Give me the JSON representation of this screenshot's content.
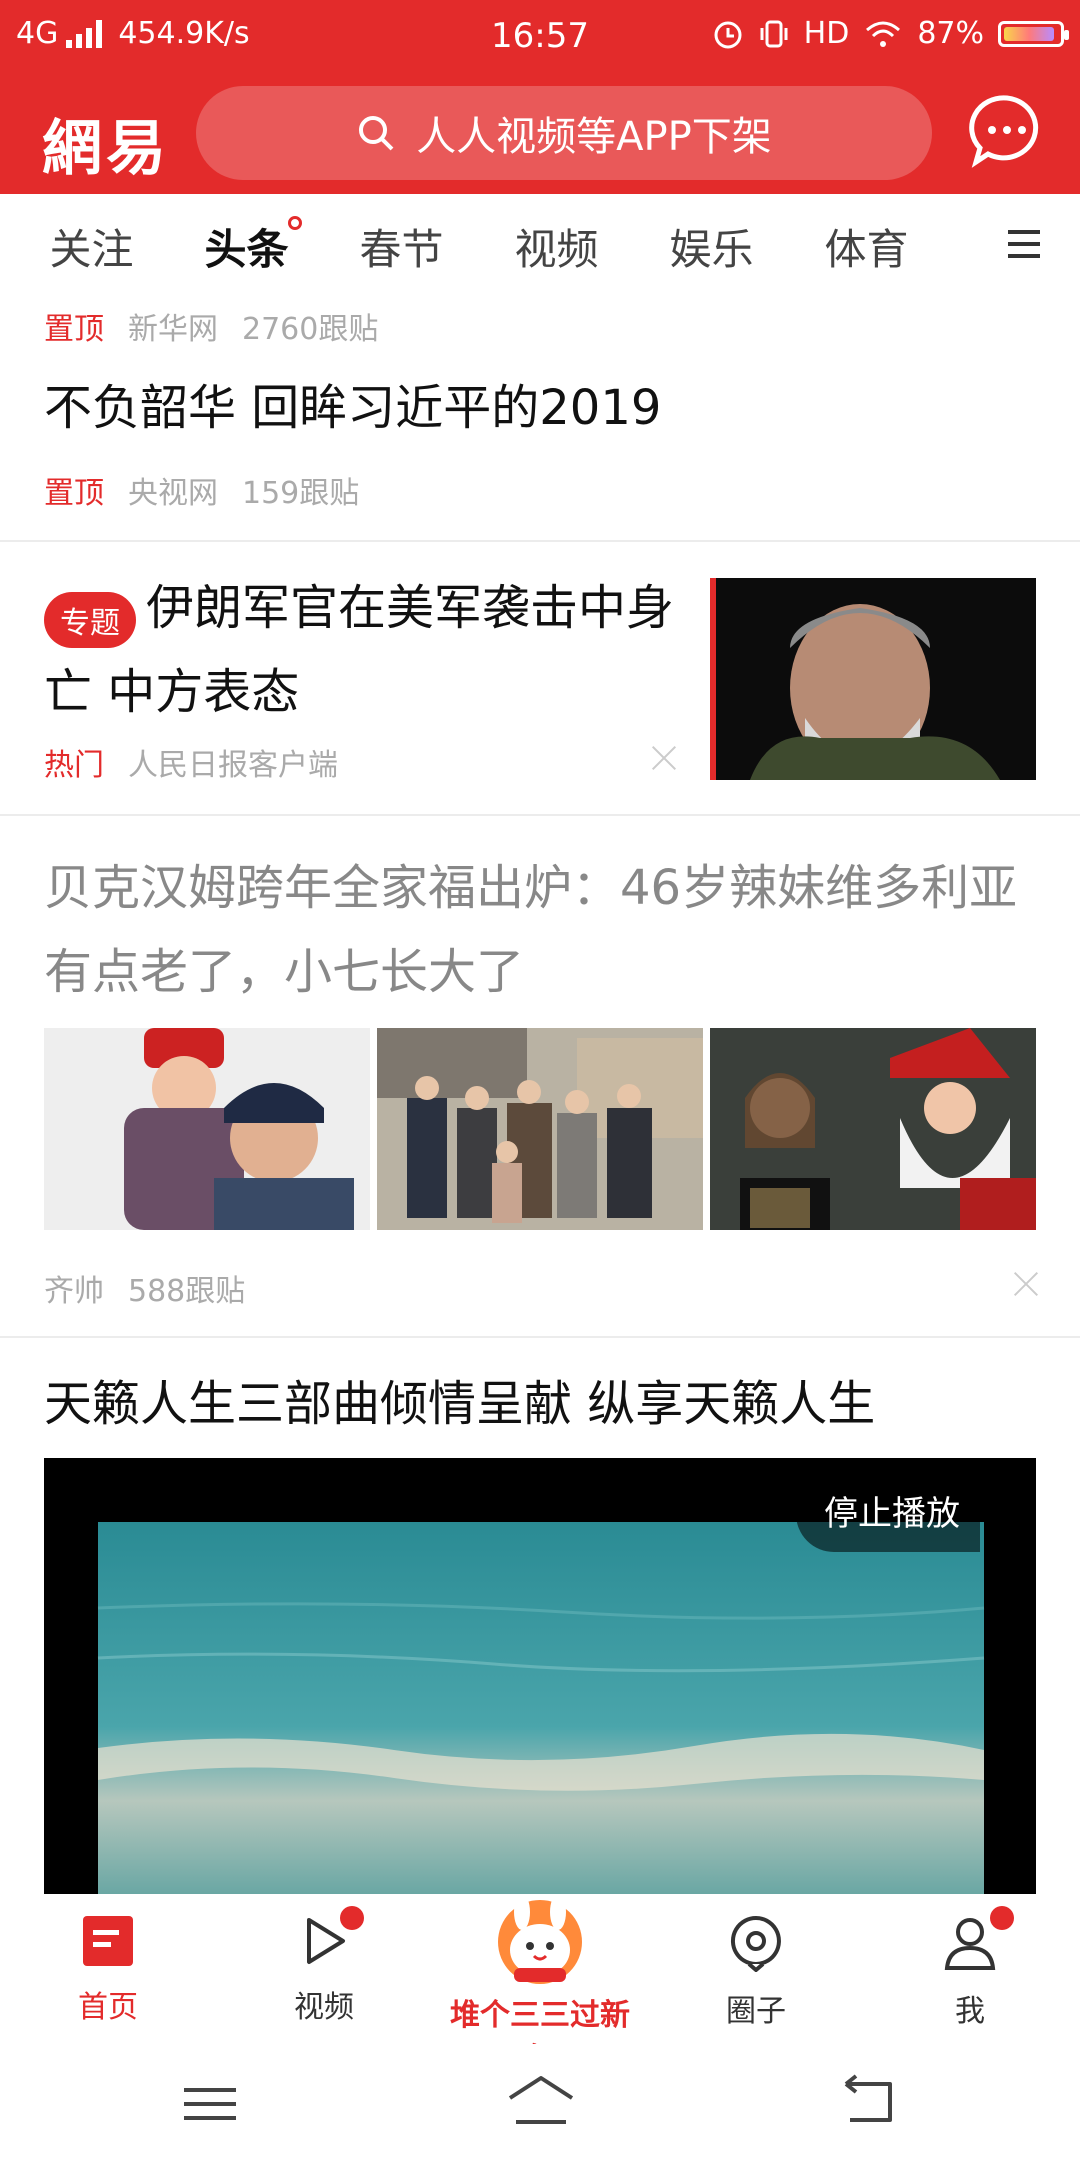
{
  "status": {
    "network": "4G",
    "speed": "454.9K/s",
    "time": "16:57",
    "hd": "HD",
    "battery": "87%",
    "battery_level": 0.87
  },
  "header": {
    "logo": "網易",
    "search_text": "人人视频等APP下架"
  },
  "tabs": [
    "关注",
    "头条",
    "春节",
    "视频",
    "娱乐",
    "体育"
  ],
  "feed": {
    "item1": {
      "top_meta": {
        "tag": "置顶",
        "source": "新华网",
        "comments": "2760跟贴"
      },
      "title": "不负韶华 回眸习近平的2019",
      "meta": {
        "tag": "置顶",
        "source": "央视网",
        "comments": "159跟贴"
      }
    },
    "item2": {
      "badge": "专题",
      "title": "伊朗军官在美军袭击中身亡 中方表态",
      "meta": {
        "tag": "热门",
        "source": "人民日报客户端"
      }
    },
    "item3": {
      "title": "贝克汉姆跨年全家福出炉：46岁辣妹维多利亚有点老了，小七长大了",
      "meta": {
        "source": "齐帅",
        "comments": "588跟贴"
      }
    },
    "item4": {
      "title": "天籁人生三部曲倾情呈献 纵享天籁人生",
      "video_button": "停止播放"
    }
  },
  "bottom_nav": [
    {
      "label": "首页"
    },
    {
      "label": "视频"
    },
    {
      "label": "堆个三三过新年"
    },
    {
      "label": "圈子"
    },
    {
      "label": "我"
    }
  ],
  "colors": {
    "brand_red": "#e32b2b",
    "meta_gray": "#aaaaaa"
  }
}
